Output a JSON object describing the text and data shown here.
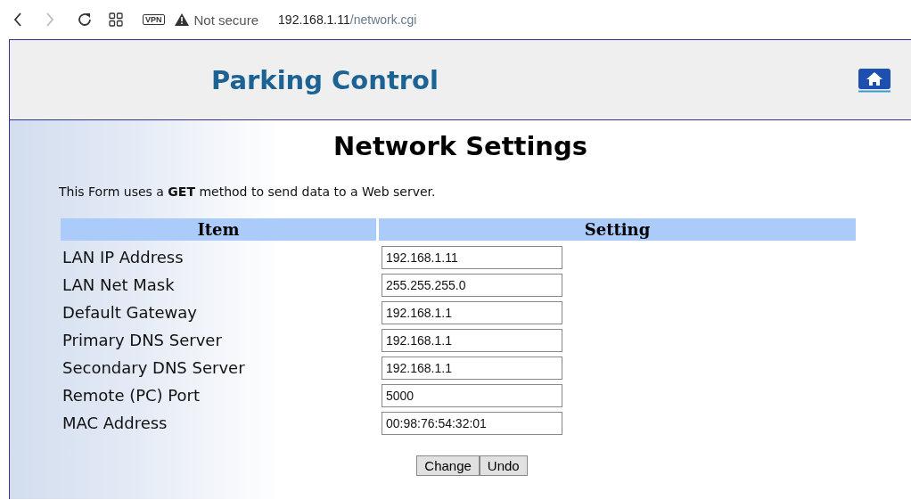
{
  "browser": {
    "vpn_badge": "VPN",
    "security_label": "Not secure",
    "url_host": "192.168.1.11",
    "url_path": "/network.cgi"
  },
  "header": {
    "title": "Parking Control"
  },
  "page": {
    "title": "Network Settings",
    "description": "This Form uses a **GET** method to send data to a Web server."
  },
  "table": {
    "columns": [
      "Item",
      "Setting"
    ],
    "rows": [
      {
        "label": "LAN IP Address",
        "value": "192.168.1.11"
      },
      {
        "label": "LAN Net Mask",
        "value": "255.255.255.0"
      },
      {
        "label": "Default Gateway",
        "value": "192.168.1.1"
      },
      {
        "label": "Primary DNS Server",
        "value": "192.168.1.1"
      },
      {
        "label": "Secondary DNS Server",
        "value": "192.168.1.1"
      },
      {
        "label": "Remote (PC) Port",
        "value": "5000"
      },
      {
        "label": "MAC Address",
        "value": "00:98:76:54:32:01"
      }
    ]
  },
  "buttons": [
    "Change",
    "Undo"
  ]
}
